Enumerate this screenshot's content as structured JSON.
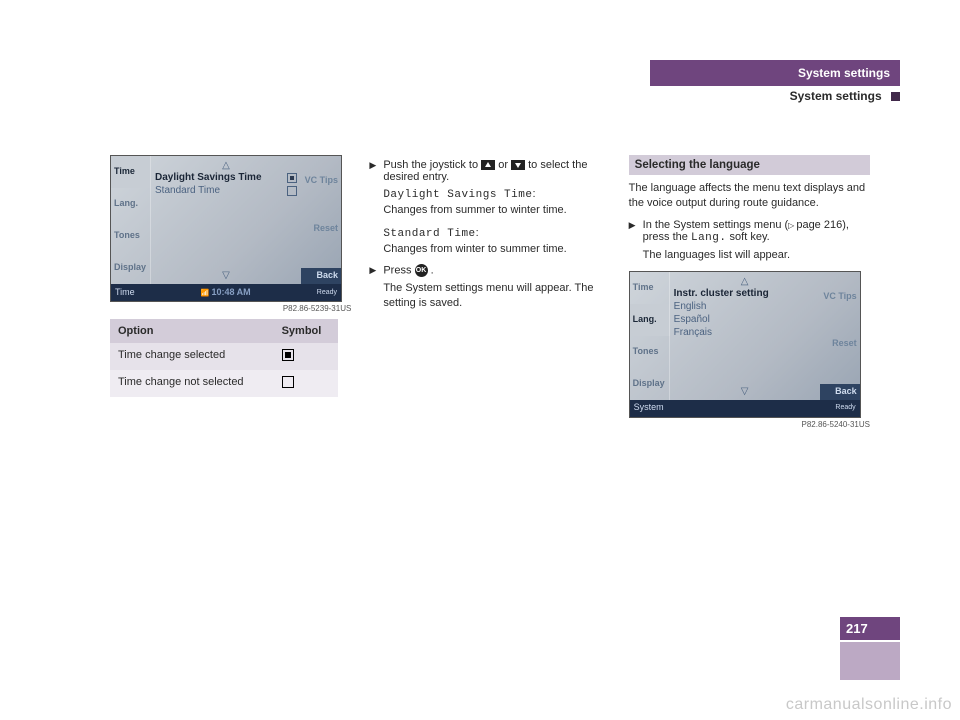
{
  "header": {
    "title_bar": "System settings",
    "subtitle": "System settings"
  },
  "page_number": "217",
  "watermark": "carmanualsonline.info",
  "fig1": {
    "caption": "P82.86-5239-31US",
    "left": {
      "time": "Time",
      "lang": "Lang.",
      "tones": "Tones",
      "display": "Display"
    },
    "right": {
      "vctips": "VC Tips",
      "reset": "Reset",
      "back": "Back"
    },
    "mid": {
      "line1": "Daylight Savings Time",
      "line2": "Standard Time"
    },
    "foot": {
      "label": "Time",
      "clock": "10:48 AM",
      "ready": "Ready"
    }
  },
  "opt_table": {
    "h1": "Option",
    "h2": "Symbol",
    "r1": "Time change selected",
    "r2": "Time change not selected"
  },
  "col2": {
    "step1a": "Push the joystick to ",
    "step1b": " or ",
    "step1c": " to select the desired entry.",
    "dst_label": "Daylight Savings Time",
    "dst_text": "Changes from summer to winter time.",
    "std_label": "Standard Time",
    "std_text": "Changes from winter to summer time.",
    "press": "Press ",
    "press_after": ".",
    "result": "The System settings menu will appear. The setting is saved."
  },
  "col3": {
    "section": "Selecting the language",
    "intro": "The language affects the menu text displays and the voice output during route guidance.",
    "step_a": "In the System settings menu (",
    "step_pageref": "page 216",
    "step_b": "), press the ",
    "step_soft": "Lang.",
    "step_c": " soft key.",
    "result": "The languages list will appear."
  },
  "fig2": {
    "caption": "P82.86-5240-31US",
    "left": {
      "time": "Time",
      "lang": "Lang.",
      "tones": "Tones",
      "display": "Display"
    },
    "right": {
      "vctips": "VC Tips",
      "reset": "Reset",
      "back": "Back"
    },
    "mid": {
      "title": "Instr. cluster setting",
      "l1": "English",
      "l2": "Español",
      "l3": "Français"
    },
    "foot": {
      "label": "System",
      "ready": "Ready"
    }
  }
}
